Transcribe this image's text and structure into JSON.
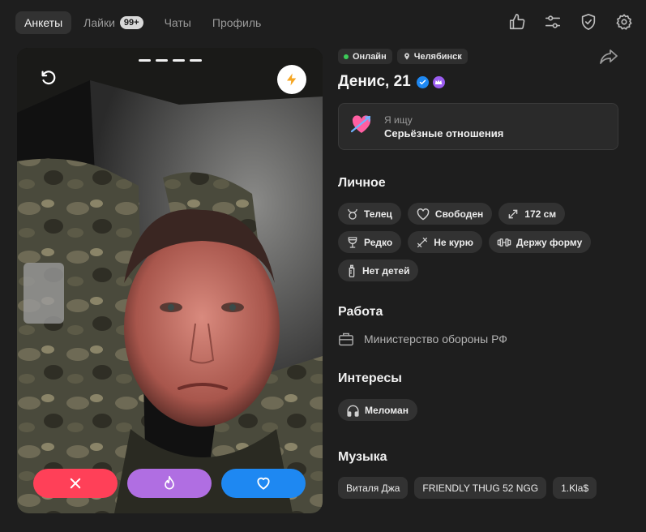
{
  "nav": {
    "tabs": [
      {
        "label": "Анкеты",
        "active": true
      },
      {
        "label": "Лайки",
        "badge": "99+"
      },
      {
        "label": "Чаты"
      },
      {
        "label": "Профиль"
      }
    ],
    "icons": [
      "thumbs-up-icon",
      "filters-icon",
      "shield-check-icon",
      "gear-icon"
    ]
  },
  "photo": {
    "photo_count": 4,
    "current_photo": 1
  },
  "actions": {
    "colors": {
      "nope": "#ff4058",
      "super": "#b06ee2",
      "like": "#1e88f2"
    }
  },
  "profile": {
    "status": "Онлайн",
    "city": "Челябинск",
    "name_age": "Денис, 21",
    "seeking_label": "Я ищу",
    "seeking_value": "Серьёзные отношения"
  },
  "personal": {
    "title": "Личное",
    "tags": [
      {
        "icon": "taurus-icon",
        "label": "Телец"
      },
      {
        "icon": "heart-outline-icon",
        "label": "Свободен"
      },
      {
        "icon": "height-arrows-icon",
        "label": "172 см"
      },
      {
        "icon": "wine-glass-icon",
        "label": "Редко"
      },
      {
        "icon": "no-smoking-icon",
        "label": "Не курю"
      },
      {
        "icon": "dumbbell-icon",
        "label": "Держу форму"
      },
      {
        "icon": "baby-bottle-icon",
        "label": "Нет детей"
      }
    ]
  },
  "work": {
    "title": "Работа",
    "value": "Министерство обороны РФ"
  },
  "interests": {
    "title": "Интересы",
    "tags": [
      {
        "icon": "headphones-icon",
        "label": "Меломан"
      }
    ]
  },
  "music": {
    "title": "Музыка",
    "tags": [
      "Виталя Джа",
      "FRIENDLY THUG 52 NGG",
      "1.Kla$"
    ]
  }
}
